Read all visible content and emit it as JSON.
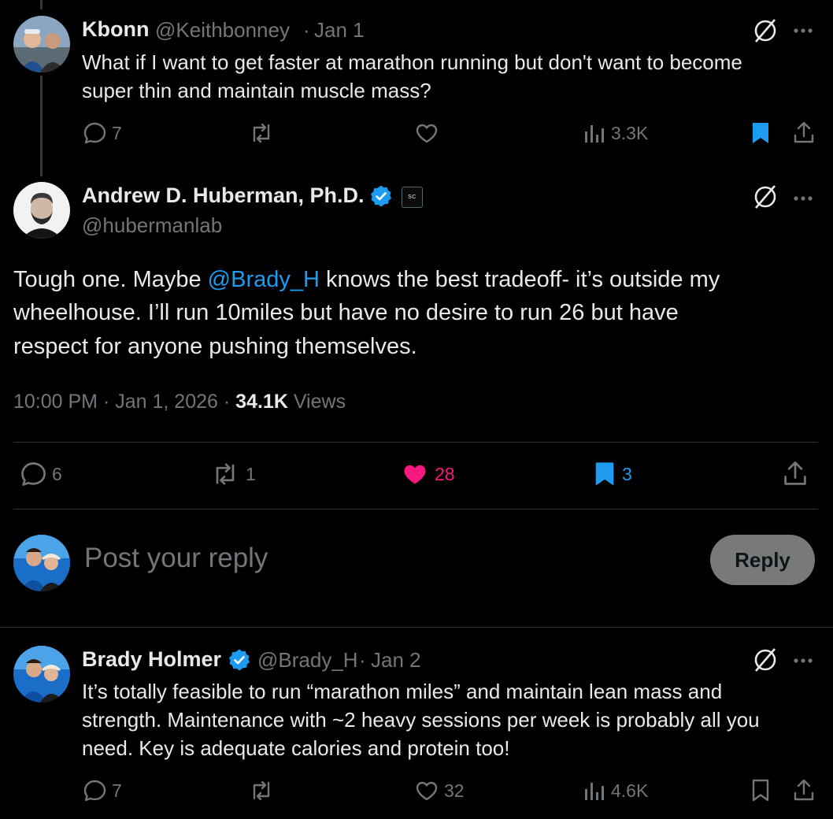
{
  "colors": {
    "background": "#000000",
    "text": "#e7e9ea",
    "muted": "#71767b",
    "link": "#1d9bf0",
    "like_active": "#f91880",
    "bookmark_active": "#1d9bf0"
  },
  "parent_tweet": {
    "name": "Kbonn",
    "handle": "@Keithbonney",
    "sep": "·",
    "date": "Jan 1",
    "text_line1": "What if I want to get faster at marathon running but don't want to become",
    "text_line2": "super thin and maintain muscle mass?",
    "replies": "7",
    "views": "3.3K",
    "bookmarked": true
  },
  "main_tweet": {
    "name": "Andrew D. Huberman, Ph.D.",
    "handle": "@hubermanlab",
    "affiliate_badge": "SC",
    "text_part1": "Tough one. Maybe ",
    "mention": "@Brady_H",
    "text_part2": " knows the best tradeoff- it’s outside my",
    "text_line2": "wheelhouse. I’ll run 10miles but have no desire to run 26 but have",
    "text_line3": "respect for anyone pushing themselves.",
    "time": "10:00 PM",
    "date": "Jan 1, 2026",
    "sep": "·",
    "views_count": "34.1K",
    "views_label": "Views",
    "replies": "6",
    "reposts": "1",
    "likes": "28",
    "bookmarks": "3"
  },
  "reply_box": {
    "placeholder": "Post your reply",
    "button": "Reply"
  },
  "reply_tweet": {
    "name": "Brady Holmer",
    "handle": "@Brady_H",
    "sep": "·",
    "date": "Jan 2",
    "text_line1": "It’s totally feasible to run “marathon miles” and maintain lean mass and",
    "text_line2": "strength. Maintenance with ~2 heavy sessions per week is probably all you",
    "text_line3": "need. Key is adequate calories and protein too!",
    "replies": "7",
    "likes": "32",
    "views": "4.6K"
  }
}
